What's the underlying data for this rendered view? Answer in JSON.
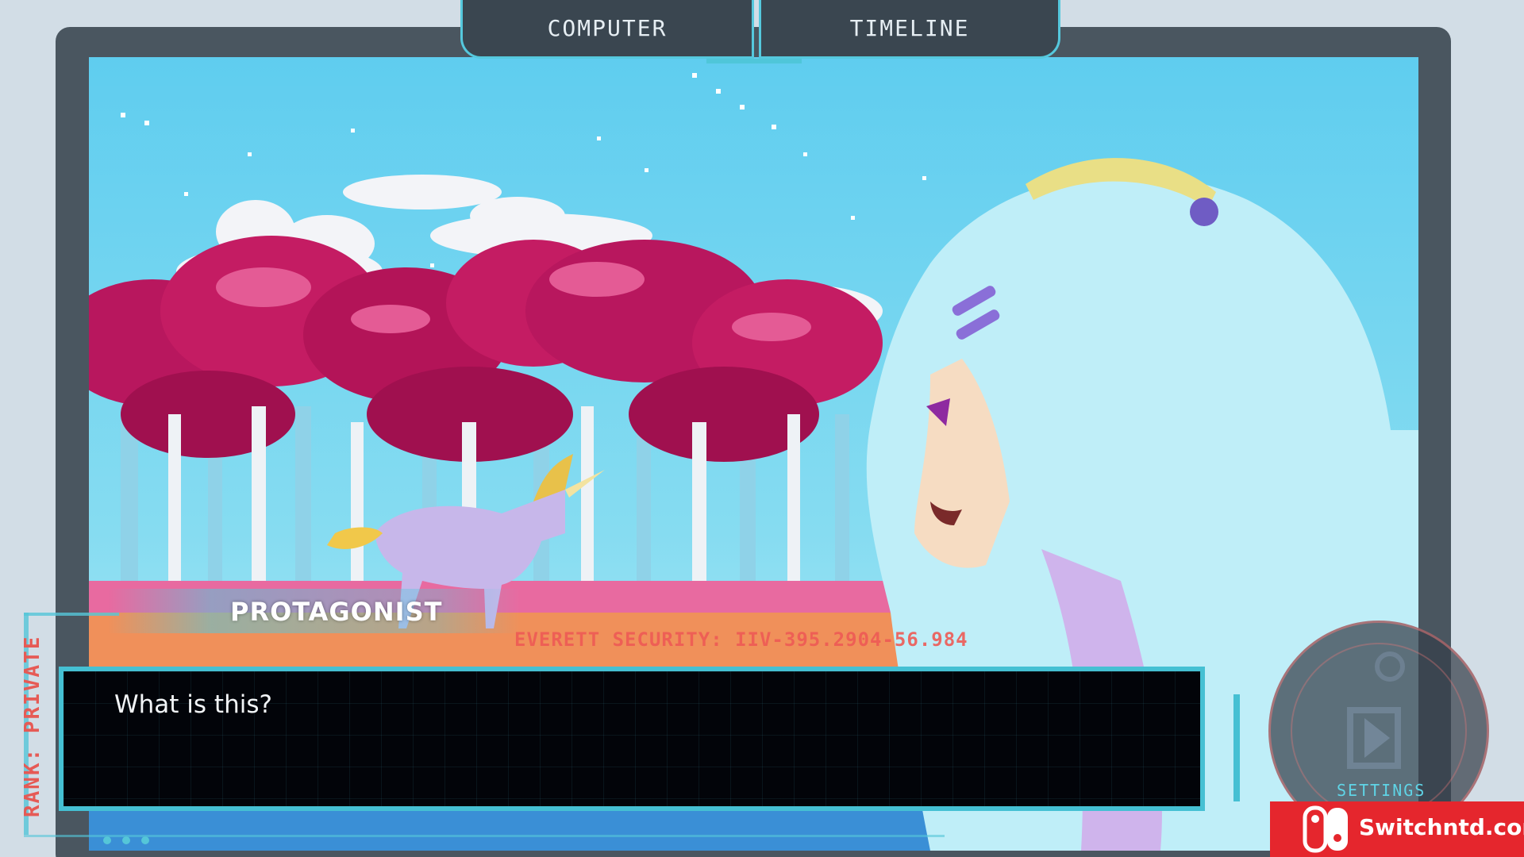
{
  "tabs": {
    "computer_label": "COMPUTER",
    "timeline_label": "TIMELINE"
  },
  "dialogue": {
    "speaker": "PROTAGONIST",
    "text": "What is this?",
    "security_code": "EVERETT SECURITY: IIV-395.2904-56.984"
  },
  "hud": {
    "rank": "RANK: PRIVATE",
    "settings_label": "SETTINGS"
  },
  "watermark": {
    "text": "Switchntd.com"
  },
  "colors": {
    "frame": "#4a5660",
    "accent_cyan": "#45c0d3",
    "alert_red": "#e65a55",
    "dialogue_bg": "#020409",
    "sky": "#67d3ee",
    "tree_magenta": "#c0185e",
    "watermark_red": "#e5262d"
  }
}
